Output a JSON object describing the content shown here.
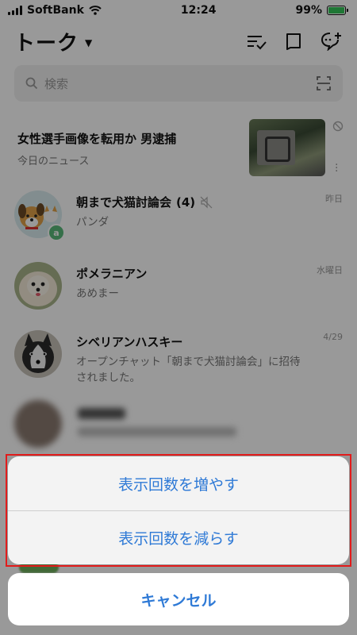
{
  "status_bar": {
    "carrier": "SoftBank",
    "time": "12:24",
    "battery": "99%",
    "battery_level": 0.99
  },
  "header": {
    "title": "トーク"
  },
  "search": {
    "placeholder": "検索"
  },
  "news": {
    "headline": "女性選手画像を転用か 男逮捕",
    "source": "今日のニュース"
  },
  "chats": [
    {
      "name": "朝まで犬猫討論会",
      "count": "(4)",
      "message": "パンダ",
      "time": "昨日",
      "muted": true,
      "badge": "a"
    },
    {
      "name": "ポメラニアン",
      "message": "あめまー",
      "time": "水曜日"
    },
    {
      "name": "シベリアンハスキー",
      "message": "オープンチャット「朝まで犬猫討論会」に招待されました。",
      "time": "4/29"
    }
  ],
  "action_sheet": {
    "options": [
      {
        "label": "表示回数を増やす"
      },
      {
        "label": "表示回数を減らす"
      }
    ],
    "cancel_label": "キャンセル"
  },
  "colors": {
    "action_text": "#2f7ad6",
    "highlight_border": "#e21b1b",
    "badge": "#59b97a",
    "battery": "#35c759"
  }
}
